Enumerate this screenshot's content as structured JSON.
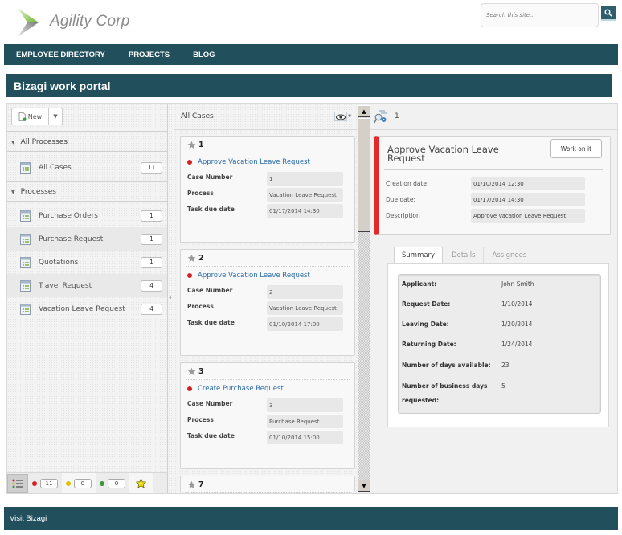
{
  "header": {
    "brand": "Agility Corp",
    "search_placeholder": "Search this site...",
    "colors": {
      "nav_bg": "#214f5c",
      "logo_green": "#7bc142",
      "logo_gray": "#9a9a9a"
    }
  },
  "topnav": [
    "EMPLOYEE DIRECTORY",
    "PROJECTS",
    "BLOG"
  ],
  "portal_title": "Bizagi work portal",
  "left_panel": {
    "new_label": "New",
    "all_processes_label": "All Processes",
    "all_cases": {
      "label": "All Cases",
      "count": "11"
    },
    "processes_label": "Processes",
    "processes": [
      {
        "label": "Purchase Orders",
        "count": "1"
      },
      {
        "label": "Purchase Request",
        "count": "1"
      },
      {
        "label": "Quotations",
        "count": "1"
      },
      {
        "label": "Travel Request",
        "count": "4"
      },
      {
        "label": "Vacation Leave Request",
        "count": "4"
      }
    ],
    "status_counts": {
      "red": "11",
      "yellow": "0",
      "green": "0"
    },
    "status_colors": {
      "red": "#d42020",
      "yellow": "#e0c000",
      "green": "#3a9a3a"
    }
  },
  "cases_panel": {
    "title": "All Cases",
    "field_labels": {
      "case_number": "Case Number",
      "process": "Process",
      "due": "Task due date"
    },
    "cases": [
      {
        "id": "1",
        "task": "Approve Vacation Leave Request",
        "case_number": "1",
        "process": "Vacation Leave Request",
        "due": "01/17/2014 14:30"
      },
      {
        "id": "2",
        "task": "Approve Vacation Leave Request",
        "case_number": "2",
        "process": "Vacation Leave Request",
        "due": "01/10/2014 17:00"
      },
      {
        "id": "3",
        "task": "Create Purchase Request",
        "case_number": "3",
        "process": "Purchase Request",
        "due": "01/10/2014 15:00"
      },
      {
        "id": "7"
      }
    ]
  },
  "detail_panel": {
    "case_id": "1",
    "task_title": "Approve Vacation Leave Request",
    "work_button": "Work on it",
    "fields": [
      {
        "label": "Creation date:",
        "value": "01/10/2014 12:30"
      },
      {
        "label": "Due date:",
        "value": "01/17/2014 14:30"
      },
      {
        "label": "Description",
        "value": "Approve Vacation Leave Request"
      }
    ],
    "tabs": [
      "Summary",
      "Details",
      "Assignees"
    ],
    "active_tab": "Summary",
    "summary": [
      {
        "label": "Applicant:",
        "value": "John Smith"
      },
      {
        "label": "Request Date:",
        "value": "1/10/2014"
      },
      {
        "label": "Leaving Date:",
        "value": "1/20/2014"
      },
      {
        "label": "Returning Date:",
        "value": "1/24/2014"
      },
      {
        "label": "Number of days available:",
        "value": "23"
      },
      {
        "label": "Number of business days requested:",
        "value": "5"
      }
    ]
  },
  "footer": {
    "link": "Visit Bizagi"
  }
}
